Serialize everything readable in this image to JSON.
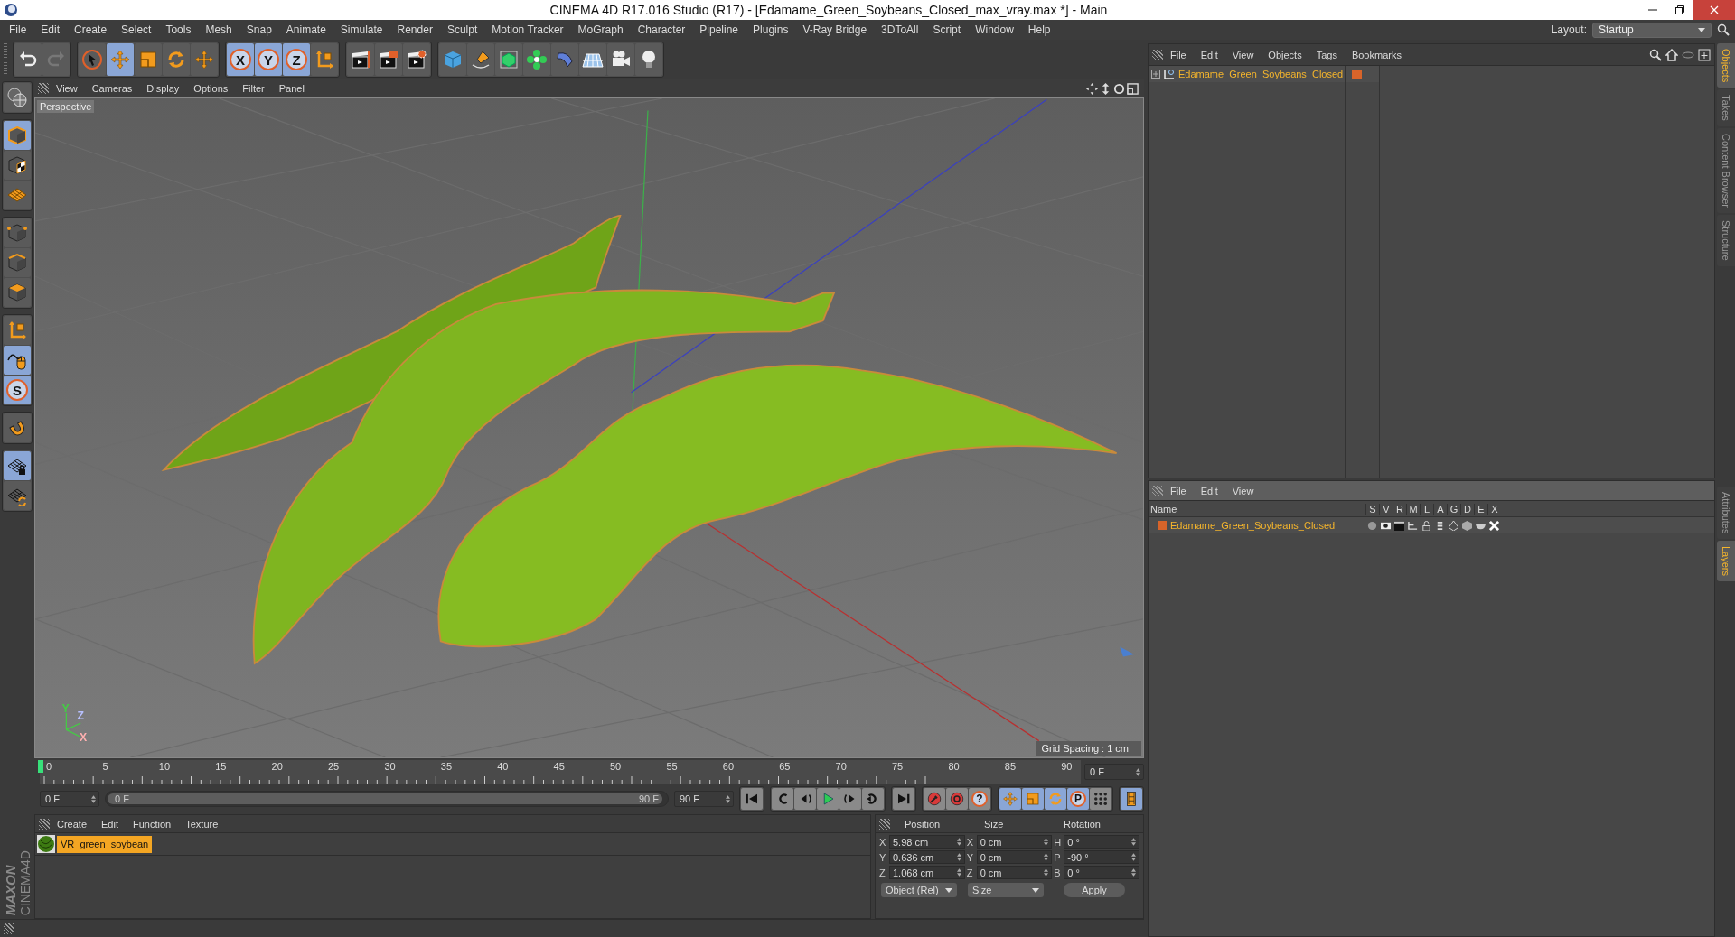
{
  "window": {
    "title": "CINEMA 4D R17.016 Studio (R17) - [Edamame_Green_Soybeans_Closed_max_vray.max *] - Main"
  },
  "menu": [
    "File",
    "Edit",
    "Create",
    "Select",
    "Tools",
    "Mesh",
    "Snap",
    "Animate",
    "Simulate",
    "Render",
    "Sculpt",
    "Motion Tracker",
    "MoGraph",
    "Character",
    "Pipeline",
    "Plugins",
    "V-Ray Bridge",
    "3DToAll",
    "Script",
    "Window",
    "Help"
  ],
  "layout": {
    "label": "Layout:",
    "value": "Startup"
  },
  "toolbar": [
    {
      "items": [
        {
          "kind": "undo",
          "active": false
        },
        {
          "kind": "redo",
          "active": false
        }
      ]
    },
    {
      "items": [
        {
          "kind": "cursor",
          "active": false
        },
        {
          "kind": "move",
          "active": true
        },
        {
          "kind": "scale",
          "active": false
        },
        {
          "kind": "rotate",
          "active": false
        },
        {
          "kind": "transform",
          "active": false
        }
      ]
    },
    {
      "items": [
        {
          "kind": "letter",
          "label": "X",
          "active": true
        },
        {
          "kind": "letter",
          "label": "Y",
          "active": true
        },
        {
          "kind": "letter",
          "label": "Z",
          "active": true
        },
        {
          "kind": "axes",
          "active": false
        }
      ]
    },
    {
      "items": [
        {
          "kind": "clapper",
          "active": false
        },
        {
          "kind": "renderclip",
          "active": false
        },
        {
          "kind": "rendergear",
          "active": false
        }
      ]
    },
    {
      "items": [
        {
          "kind": "cube",
          "active": false
        },
        {
          "kind": "pen",
          "active": false
        },
        {
          "kind": "subdivision",
          "active": false
        },
        {
          "kind": "cloner",
          "active": false
        },
        {
          "kind": "bend",
          "active": false
        },
        {
          "kind": "floor",
          "active": false
        },
        {
          "kind": "camera",
          "active": false
        },
        {
          "kind": "bulb",
          "active": false
        }
      ]
    }
  ],
  "tools": [
    {
      "items": [
        {
          "kind": "globes",
          "active": false
        }
      ]
    },
    {
      "items": [
        {
          "kind": "model",
          "active": true
        },
        {
          "kind": "checker",
          "active": false
        },
        {
          "kind": "workplane",
          "active": false
        }
      ]
    },
    {
      "items": [
        {
          "kind": "points",
          "active": false
        },
        {
          "kind": "edges",
          "active": false
        },
        {
          "kind": "polygons",
          "active": false
        }
      ]
    },
    {
      "items": [
        {
          "kind": "axes",
          "active": false
        },
        {
          "kind": "mouse",
          "active": true
        },
        {
          "kind": "letter",
          "label": "S",
          "active": true
        }
      ]
    },
    {
      "items": [
        {
          "kind": "magnet",
          "active": false
        }
      ]
    },
    {
      "items": [
        {
          "kind": "gridlock",
          "active": true
        },
        {
          "kind": "gridsync",
          "active": false
        }
      ]
    }
  ],
  "viewport": {
    "menu": [
      "View",
      "Cameras",
      "Display",
      "Options",
      "Filter",
      "Panel"
    ],
    "camera": "Perspective",
    "grid_spacing": "Grid Spacing : 1 cm",
    "gizmo": [
      "Y",
      "Z",
      "X"
    ]
  },
  "timeline": {
    "ticks": [
      "0",
      "5",
      "10",
      "15",
      "20",
      "25",
      "30",
      "35",
      "40",
      "45",
      "50",
      "55",
      "60",
      "65",
      "70",
      "75",
      "80",
      "85",
      "90"
    ],
    "level": 0,
    "current_frame": "0 F",
    "start": "0 F",
    "range": {
      "start": "0 F",
      "end": "90 F",
      "level": 1
    },
    "end": "90 F",
    "controls": [
      {
        "items": [
          {
            "kind": "first",
            "active": false
          }
        ]
      },
      {
        "items": [
          {
            "kind": "prevkey",
            "active": false
          },
          {
            "kind": "prev",
            "active": false
          },
          {
            "kind": "play",
            "active": false
          },
          {
            "kind": "next",
            "active": false
          },
          {
            "kind": "nextkey",
            "active": false
          }
        ]
      },
      {
        "items": [
          {
            "kind": "last",
            "active": false
          }
        ]
      },
      {
        "items": [
          {
            "kind": "record",
            "active": false
          },
          {
            "kind": "autokey",
            "active": false
          },
          {
            "kind": "letter",
            "label": "?",
            "active": false
          }
        ]
      },
      {
        "items": [
          {
            "kind": "move",
            "active": true
          },
          {
            "kind": "scale",
            "active": true
          },
          {
            "kind": "rotate",
            "active": true
          },
          {
            "kind": "letter",
            "label": "P",
            "active": true
          },
          {
            "kind": "dots",
            "active": false
          }
        ]
      },
      {
        "items": [
          {
            "kind": "filmstrip",
            "active": true
          }
        ]
      }
    ]
  },
  "materials": {
    "menu": [
      "Create",
      "Edit",
      "Function",
      "Texture"
    ],
    "items": [
      {
        "name": "VR_green_soybean",
        "selected": true
      }
    ]
  },
  "coordinates": {
    "headers": [
      "Position",
      "Size",
      "Rotation"
    ],
    "rows": [
      [
        {
          "axis": "X",
          "value": "5.98 cm"
        },
        {
          "axis": "X",
          "value": "0 cm"
        },
        {
          "axis": "H",
          "value": "0 °"
        }
      ],
      [
        {
          "axis": "Y",
          "value": "0.636 cm"
        },
        {
          "axis": "Y",
          "value": "0 cm"
        },
        {
          "axis": "P",
          "value": "-90 °"
        }
      ],
      [
        {
          "axis": "Z",
          "value": "1.068 cm"
        },
        {
          "axis": "Z",
          "value": "0 cm"
        },
        {
          "axis": "B",
          "value": "0 °"
        }
      ]
    ],
    "mode": "Object (Rel)",
    "size_mode": "Size",
    "apply": "Apply"
  },
  "branding": {
    "company": "MAXON",
    "product": "CINEMA4D"
  },
  "objects": {
    "menu": [
      "File",
      "Edit",
      "View",
      "Objects",
      "Tags",
      "Bookmarks"
    ],
    "items": [
      {
        "name": "Edamame_Green_Soybeans_Closed",
        "selected": true
      }
    ]
  },
  "layers": {
    "menu": [
      "File",
      "Edit",
      "View"
    ],
    "columns": [
      "Name",
      "S",
      "V",
      "R",
      "M",
      "L",
      "A",
      "G",
      "D",
      "E",
      "X"
    ],
    "items": [
      {
        "name": "Edamame_Green_Soybeans_Closed",
        "selected": true
      }
    ]
  },
  "side_tabs": {
    "top": [
      {
        "label": "Objects",
        "selected": true
      },
      {
        "label": "Takes",
        "selected": false
      },
      {
        "label": "Content Browser",
        "selected": false
      },
      {
        "label": "Structure",
        "selected": false
      }
    ],
    "bottom": [
      {
        "label": "Attributes",
        "selected": false
      },
      {
        "label": "Layers",
        "selected": true
      }
    ]
  }
}
